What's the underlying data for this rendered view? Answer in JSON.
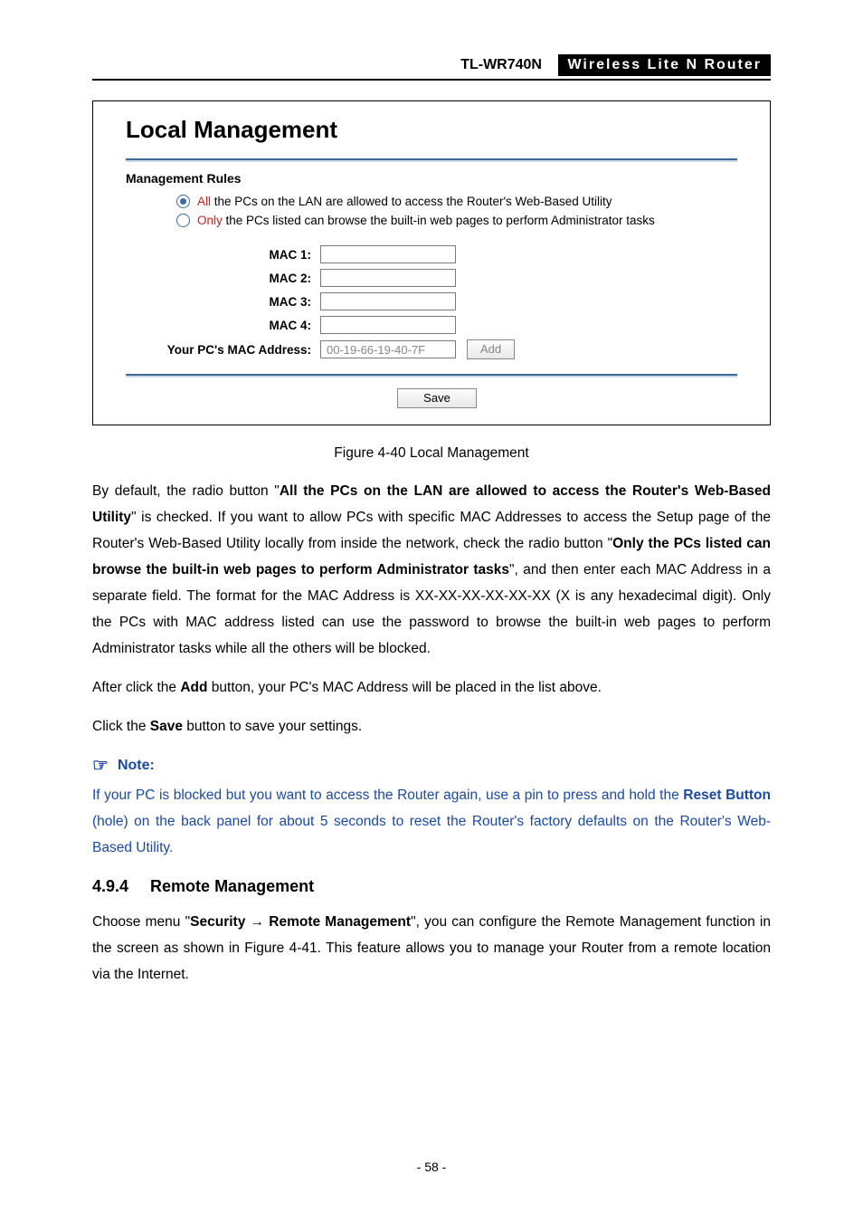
{
  "header": {
    "model": "TL-WR740N",
    "product": "Wireless Lite N Router"
  },
  "screenshot": {
    "title": "Local Management",
    "subhead": "Management Rules",
    "radio1": {
      "hl": "All",
      "rest": " the PCs on the LAN are allowed to access the Router's Web-Based Utility",
      "checked": true
    },
    "radio2": {
      "hl": "Only",
      "rest": " the PCs listed can browse the built-in web pages to perform Administrator tasks",
      "checked": false
    },
    "mac_labels": [
      "MAC 1:",
      "MAC 2:",
      "MAC 3:",
      "MAC 4:"
    ],
    "mac_values": [
      "",
      "",
      "",
      ""
    ],
    "your_mac_label": "Your PC's MAC Address:",
    "your_mac_value": "00-19-66-19-40-7F",
    "add_btn": "Add",
    "save_btn": "Save"
  },
  "caption": "Figure 4-40 Local Management",
  "para1": {
    "t1": "By default, the radio button \"",
    "b1": "All the PCs on the LAN are allowed to access the Router's Web-Based Utility",
    "t2": "\" is checked. If you want to allow PCs with specific MAC Addresses to access the Setup page of the Router's Web-Based Utility locally from inside the network, check the radio button \"",
    "b2": "Only the PCs listed can browse the built-in web pages to perform Administrator tasks",
    "t3": "\", and then enter each MAC Address in a separate field. The format for the MAC Address is XX-XX-XX-XX-XX-XX (X is any hexadecimal digit). Only the PCs with MAC address listed can use the password to browse the built-in web pages to perform Administrator tasks while all the others will be blocked."
  },
  "para2": {
    "t1": "After click the ",
    "b1": "Add",
    "t2": " button, your PC's MAC Address will be placed in the list above."
  },
  "para3": {
    "t1": "Click the ",
    "b1": "Save",
    "t2": " button to save your settings."
  },
  "note": {
    "head": "Note:",
    "t1": "If your PC is blocked but you want to access the Router again, use a pin to press and hold the ",
    "b1": "Reset Button",
    "t2": " (hole) on the back panel for about 5 seconds to reset the Router's factory defaults on the Router's Web-Based Utility."
  },
  "section": {
    "num": "4.9.4",
    "title": "Remote Management"
  },
  "para4": {
    "t1": "Choose menu \"",
    "b1": "Security",
    "arrow": " → ",
    "b2": "Remote Management",
    "t2": "\", you can configure the Remote Management function in the screen as shown in Figure 4-41. This feature allows you to manage your Router from a remote location via the Internet."
  },
  "pagenum": "- 58 -"
}
